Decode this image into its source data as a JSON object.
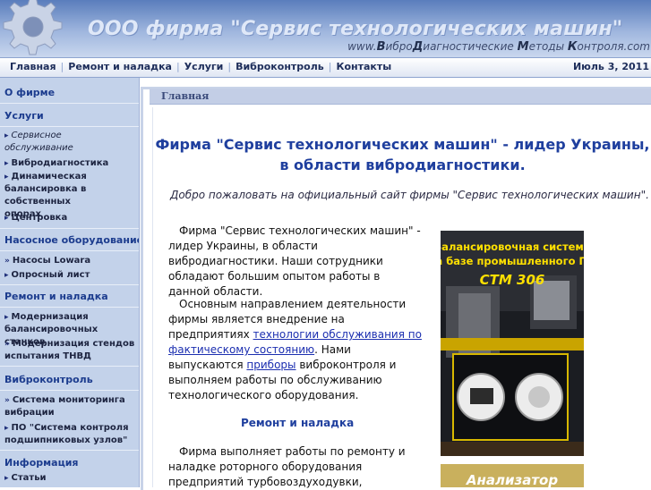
{
  "header": {
    "title": "ООО фирма \"Сервис технологических машин\"",
    "slogan_www": "www.",
    "slogan_v": "В",
    "slogan_part1": "ибро",
    "slogan_d": "Д",
    "slogan_part2": "иагностические ",
    "slogan_m": "М",
    "slogan_part3": "етоды ",
    "slogan_k": "К",
    "slogan_part4": "онтроля.com"
  },
  "nav": {
    "items": [
      "Главная",
      "Ремонт и наладка",
      "Услуги",
      "Виброконтроль",
      "Контакты"
    ],
    "date": "Июль 3, 2011"
  },
  "sidebar": {
    "about": "О фирме",
    "services": "Услуги",
    "service_items": [
      "Сервисное обслуживание",
      "Вибродиагностика",
      "Динамическая балансировка в собственных опорах",
      "Центровка"
    ],
    "pumps": "Насосное оборудование",
    "pump_items": [
      "Насосы Lowara",
      "Опросный лист"
    ],
    "repair": "Ремонт и наладка",
    "repair_items": [
      "Модернизация балансировочных станков",
      "Модернизация стендов испытания ТНВД"
    ],
    "vibro": "Виброконтроль",
    "vibro_items": [
      "Система мониторинга вибрации",
      "ПО \"Система контроля подшипниковых узлов\""
    ],
    "info": "Информация",
    "info_items": [
      "Статьи"
    ]
  },
  "content": {
    "breadcrumb": "Главная",
    "headline": "Фирма \"Сервис технологических машин\" - лидер Украины, в области вибродиагностики.",
    "welcome": "Добро пожаловать на официальный сайт фирмы \"Сервис технологических машин\".",
    "p1": "Фирма \"Сервис технологических машин\" - лидер Украины, в области вибродиагностики. Наши сотрудники обладают большим опытом работы в данной области.",
    "p2_start": "Основным направлением деятельности фирмы является внедрение на предприятиях ",
    "p2_link": "технологии обслуживания по фактическому состоянию",
    "p2_mid": ". Нами выпускаются ",
    "p2_link2": "приборы",
    "p2_end": " виброконтроля и выполняем работы по обслуживанию технологического оборудования.",
    "subhead": "Ремонт и наладка",
    "p3": "Фирма выполняет работы по ремонту и наладке роторного оборудования предприятий турбовоздуходувки,"
  },
  "ads": {
    "ad1_line1": "Балансировочная система",
    "ad1_line2": "на базе промышленного ПК",
    "ad1_model": "СТМ 306",
    "ad2_text": "Анализатор"
  },
  "colors": {
    "header_blue": "#5a7dbc",
    "sidebar_bg": "#c3d2ea",
    "heading_blue": "#1f3f9e",
    "ad_yellow": "#ffe000"
  }
}
